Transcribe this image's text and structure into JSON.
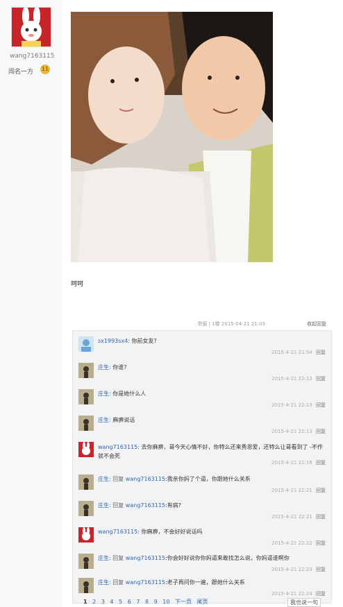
{
  "author": {
    "username": "wang7163115",
    "rank": "闯名一方",
    "level": "11"
  },
  "post": {
    "text": "呵呵"
  },
  "reply_bar": {
    "meta": "举报 | 1楼 2015-04-21 21:03",
    "collapse": "收起回复"
  },
  "comments": [
    {
      "user": "sx1993sx4:",
      "text": "你前女友?",
      "time": "2015-4-21 21:54",
      "reply": "回复"
    },
    {
      "user": "庄生:",
      "text": "你谁?",
      "time": "2015-4-21 22:13",
      "reply": "回复"
    },
    {
      "user": "庄生:",
      "text": "你是她什么人",
      "time": "2015-4-21 22:13",
      "reply": "回复"
    },
    {
      "user": "庄生:",
      "text": "麻痹说话",
      "time": "2015-4-21 22:13",
      "reply": "回复"
    },
    {
      "user": "wang7163115:",
      "text": "去你麻痹，哥今天心情不好，你特么还来秀恩爱，还特么让哥看到了 -不作就不会死",
      "time": "2015-4-21 22:16",
      "reply": "回复"
    },
    {
      "user": "庄生:",
      "prefix": "回复",
      "target": "wang7163115",
      "text": ":我亲你妈了个逼，你跟她什么关系",
      "time": "2015-4-21 22:21",
      "reply": "回复"
    },
    {
      "user": "庄生:",
      "prefix": "回复",
      "target": "wang7163115",
      "text": ":有病?",
      "time": "2015-4-21 22:21",
      "reply": "回复"
    },
    {
      "user": "wang7163115:",
      "text": "你麻痹，不会好好说话吗",
      "time": "2015-4-21 22:22",
      "reply": "回复"
    },
    {
      "user": "庄生:",
      "prefix": "回复",
      "target": "wang7163115",
      "text": ":你会好好说你你妈逼来敢找怎么说，你妈逼谁啊你",
      "time": "2015-4-21 22:23",
      "reply": "回复"
    },
    {
      "user": "庄生:",
      "prefix": "回复",
      "target": "wang7163115",
      "text": ":老子再问你一遍，跟她什么关系",
      "time": "2015-4-21 22:24",
      "reply": "回复"
    }
  ],
  "pager": {
    "pages": [
      "1",
      "2",
      "3",
      "4",
      "5",
      "6",
      "7",
      "8",
      "9",
      "10"
    ],
    "next": "下一页",
    "last": "尾页",
    "say_more": "我也说一句"
  },
  "colors": {
    "link": "#2d64b3",
    "avatar_red": "#c9242a"
  }
}
